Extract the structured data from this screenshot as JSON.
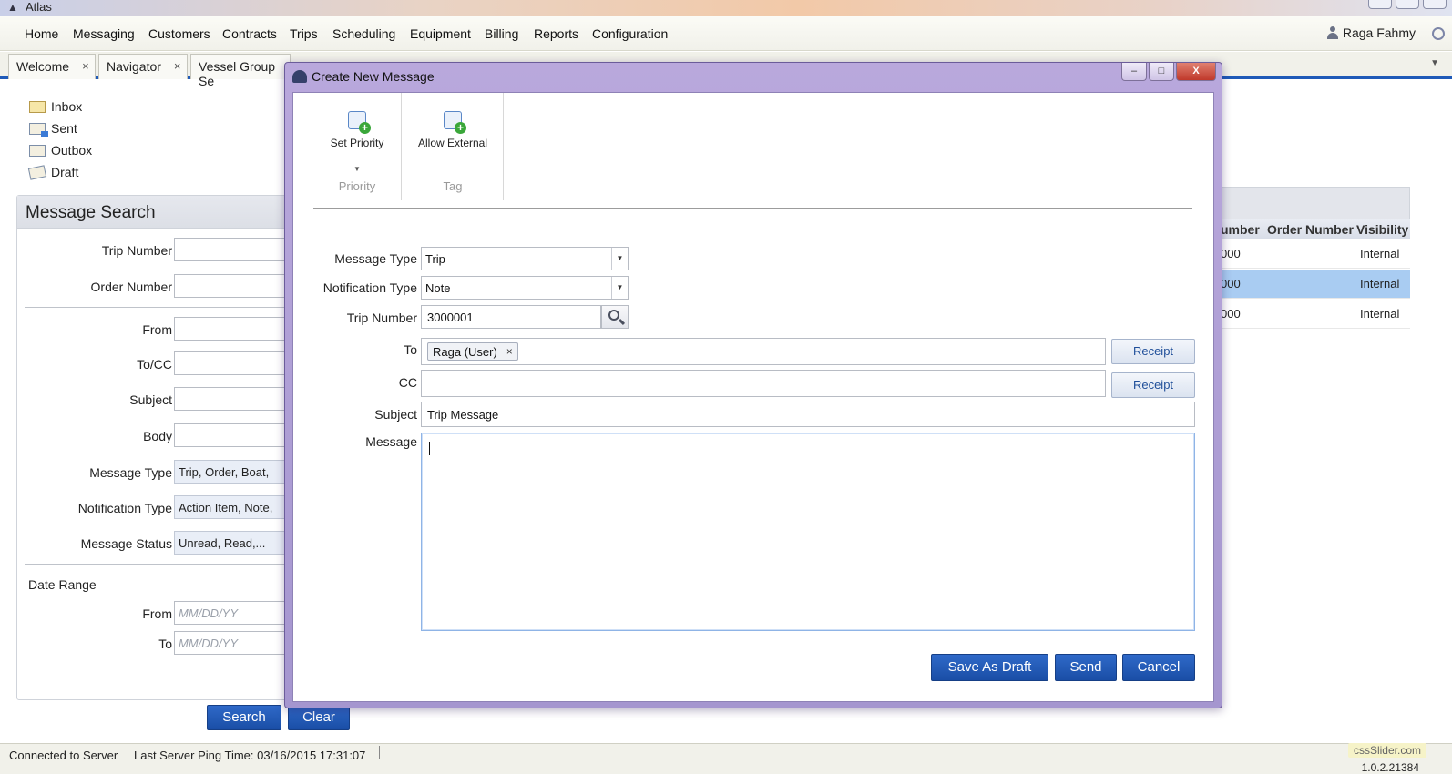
{
  "app": {
    "title": "Atlas"
  },
  "menu": [
    "Home",
    "Messaging",
    "Customers",
    "Contracts",
    "Trips",
    "Scheduling",
    "Equipment",
    "Billing",
    "Reports",
    "Configuration"
  ],
  "user": {
    "name": "Raga Fahmy"
  },
  "tabs": [
    {
      "label": "Welcome",
      "close": "×"
    },
    {
      "label": "Navigator",
      "close": "×"
    },
    {
      "label": "Vessel Group Se",
      "close": ""
    }
  ],
  "folders": [
    "Inbox",
    "Sent",
    "Outbox",
    "Draft"
  ],
  "search_panel": {
    "title": "Message Search",
    "trip_number_label": "Trip Number",
    "order_number_label": "Order Number",
    "from_label": "From",
    "tocc_label": "To/CC",
    "subject_label": "Subject",
    "body_label": "Body",
    "message_type_label": "Message Type",
    "message_type_value": "Trip, Order, Boat,",
    "notification_type_label": "Notification Type",
    "notification_type_value": "Action Item, Note,",
    "message_status_label": "Message Status",
    "message_status_value": "Unread, Read,...",
    "date_range_label": "Date Range",
    "date_from_label": "From",
    "date_to_label": "To",
    "date_placeholder": "MM/DD/YY",
    "search_button": "Search",
    "clear_button": "Clear"
  },
  "results": {
    "columns": [
      "umber",
      "Order Number",
      "Visibility"
    ],
    "rows": [
      {
        "trip": "000",
        "order": "",
        "visibility": "Internal"
      },
      {
        "trip": "000",
        "order": "",
        "visibility": "Internal"
      },
      {
        "trip": "000",
        "order": "",
        "visibility": "Internal"
      }
    ],
    "selected_row": 1
  },
  "statusbar": {
    "connection": "Connected to Server",
    "ping": "Last Server Ping Time:  03/16/2015 17:31:07",
    "version": "1.0.2.21384",
    "watermark": "cssSlider.com"
  },
  "dialog": {
    "title": "Create New Message",
    "ribbon": {
      "set_priority": "Set Priority",
      "priority_caption": "Priority",
      "allow_external": "Allow External",
      "tag_caption": "Tag"
    },
    "message_type_label": "Message Type",
    "message_type_value": "Trip",
    "notification_type_label": "Notification Type",
    "notification_type_value": "Note",
    "trip_number_label": "Trip Number",
    "trip_number_value": "3000001",
    "to_label": "To",
    "to_token": "Raga (User)",
    "token_remove": "×",
    "cc_label": "CC",
    "receipt_label": "Receipt",
    "subject_label": "Subject",
    "subject_value": "Trip Message",
    "message_label": "Message",
    "message_value": "",
    "save_draft_button": "Save As Draft",
    "send_button": "Send",
    "cancel_button": "Cancel",
    "minimize": "–",
    "maximize": "□",
    "close": "X"
  }
}
